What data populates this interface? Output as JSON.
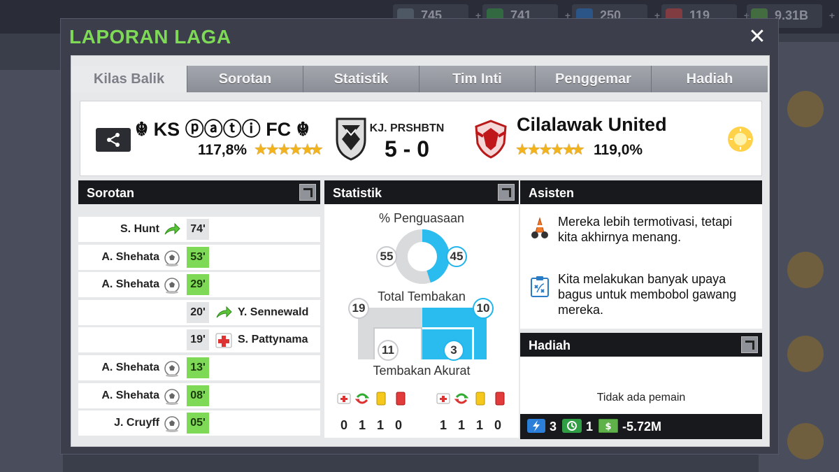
{
  "resources": [
    {
      "icon": "bronze-coin-icon",
      "value": "745"
    },
    {
      "icon": "training-icon",
      "value": "741"
    },
    {
      "icon": "energy-icon",
      "value": "250"
    },
    {
      "icon": "medical-icon",
      "value": "119"
    },
    {
      "icon": "cash-icon",
      "value": "9.31B"
    }
  ],
  "modal": {
    "title": "LAPORAN LAGA",
    "close": "✕"
  },
  "tabs": [
    "Kilas Balik",
    "Sorotan",
    "Statistik",
    "Tim Inti",
    "Penggemar",
    "Hadiah"
  ],
  "match": {
    "home": {
      "name": "☬ KS ⓟⓐⓣⓘ FC ☬",
      "rating": "117,8%",
      "stars": "★★★★★",
      "extra_star": "★"
    },
    "competition": "KJ. PRSHBTN",
    "score": "5 - 0",
    "away": {
      "name": "Cilalawak United",
      "rating": "119,0%",
      "stars": "★★★★★",
      "extra_star": "★"
    },
    "weather": "sun-icon"
  },
  "highlights": {
    "title": "Sorotan",
    "events": [
      {
        "side": "home",
        "player": "S. Hunt",
        "minute": "74'",
        "type": "substitution",
        "goal": false
      },
      {
        "side": "home",
        "player": "A. Shehata",
        "minute": "53'",
        "type": "goal",
        "goal": true
      },
      {
        "side": "home",
        "player": "A. Shehata",
        "minute": "29'",
        "type": "goal",
        "goal": true
      },
      {
        "side": "away",
        "player": "Y. Sennewald",
        "minute": "20'",
        "type": "substitution",
        "goal": false
      },
      {
        "side": "away",
        "player": "S. Pattynama",
        "minute": "19'",
        "type": "injury",
        "goal": false
      },
      {
        "side": "home",
        "player": "A. Shehata",
        "minute": "13'",
        "type": "goal",
        "goal": true
      },
      {
        "side": "home",
        "player": "A. Shehata",
        "minute": "08'",
        "type": "goal",
        "goal": true
      },
      {
        "side": "home",
        "player": "J. Cruyff",
        "minute": "05'",
        "type": "goal",
        "goal": true
      }
    ]
  },
  "stats": {
    "title": "Statistik",
    "possession_label": "% Penguasaan",
    "possession": {
      "home": "55",
      "away": "45",
      "home_frac": 0.55
    },
    "shots_label": "Total Tembakan",
    "shots": {
      "home": "19",
      "away": "10"
    },
    "on_target_label": "Tembakan Akurat",
    "on_target": {
      "home": "11",
      "away": "3"
    },
    "cards": {
      "home": [
        "0",
        "1",
        "1",
        "0"
      ],
      "away": [
        "1",
        "1",
        "1",
        "0"
      ]
    }
  },
  "assistant": {
    "title": "Asisten",
    "tips": [
      {
        "icon": "motivation-icon",
        "text": "Mereka lebih termotivasi, tetapi kita akhirnya menang."
      },
      {
        "icon": "tactics-board-icon",
        "text": "Kita melakukan banyak upaya bagus untuk membobol gawang mereka."
      }
    ]
  },
  "rewards": {
    "title": "Hadiah",
    "empty": "Tidak ada pemain",
    "energy": "3",
    "training": "1",
    "cash": "-5.72M"
  }
}
